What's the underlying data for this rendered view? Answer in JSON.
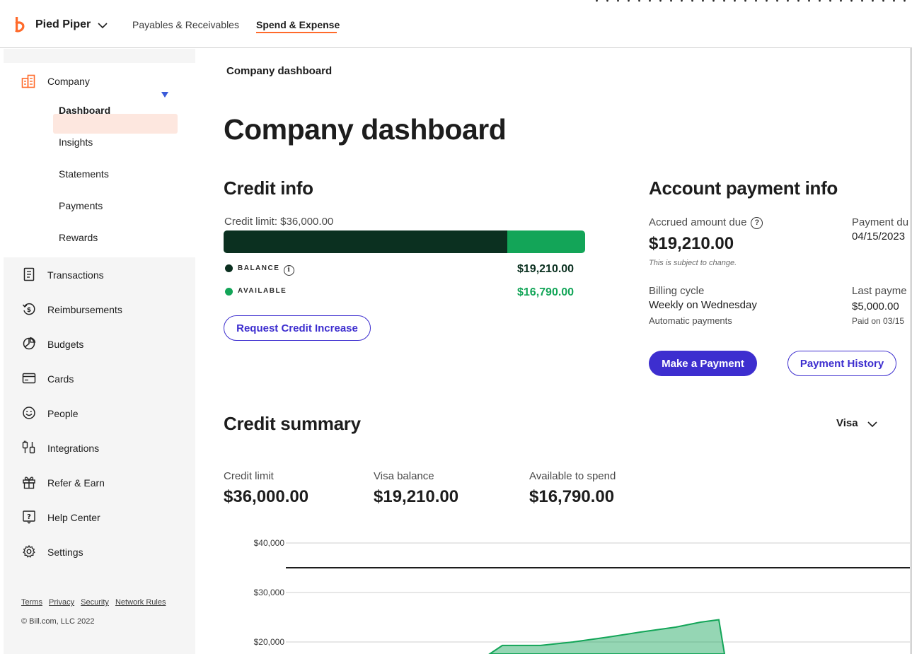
{
  "header": {
    "org_name": "Pied Piper",
    "nav": [
      {
        "label": "Payables & Receivables"
      },
      {
        "label": "Spend & Expense"
      }
    ],
    "accent_color": "#ff6a2a"
  },
  "sidebar": {
    "section": "Company",
    "sub_items": [
      {
        "label": "Dashboard",
        "active": true
      },
      {
        "label": "Insights"
      },
      {
        "label": "Statements"
      },
      {
        "label": "Payments"
      },
      {
        "label": "Rewards"
      }
    ],
    "items": [
      {
        "label": "Transactions",
        "icon": "receipt-icon"
      },
      {
        "label": "Reimbursements",
        "icon": "reimbursement-icon"
      },
      {
        "label": "Budgets",
        "icon": "pie-chart-icon"
      },
      {
        "label": "Cards",
        "icon": "card-icon"
      },
      {
        "label": "People",
        "icon": "smiley-icon"
      },
      {
        "label": "Integrations",
        "icon": "integrations-icon"
      },
      {
        "label": "Refer & Earn",
        "icon": "gift-icon"
      },
      {
        "label": "Help Center",
        "icon": "help-icon"
      },
      {
        "label": "Settings",
        "icon": "gear-icon"
      }
    ],
    "footer_links": [
      "Terms",
      "Privacy",
      "Security",
      "Network Rules"
    ],
    "copyright": "© Bill.com, LLC 2022"
  },
  "main": {
    "breadcrumb": "Company dashboard",
    "title": "Company dashboard",
    "credit_info": {
      "heading": "Credit info",
      "limit_label": "Credit limit: $36,000.00",
      "balance_label": "BALANCE",
      "balance_value": "$19,210.00",
      "available_label": "AVAILABLE",
      "available_value": "$16,790.00",
      "used_fraction": 0.784,
      "request_button": "Request Credit Increase",
      "balance_color": "#0b3020",
      "available_color": "#13a558"
    },
    "account_payment": {
      "heading": "Account payment info",
      "accrued_label": "Accrued amount due",
      "accrued_value": "$19,210.00",
      "accrued_note": "This is subject to change.",
      "payment_due_label": "Payment du",
      "payment_due_value": "04/15/2023",
      "billing_cycle_label": "Billing cycle",
      "billing_cycle_value": "Weekly on Wednesday",
      "billing_cycle_note": "Automatic payments",
      "last_payment_label": "Last payme",
      "last_payment_value": "$5,000.00",
      "last_payment_note": "Paid on 03/15",
      "make_payment_button": "Make a Payment",
      "history_button": "Payment History"
    },
    "credit_summary": {
      "heading": "Credit summary",
      "card_filter": "Visa",
      "stats": [
        {
          "label": "Credit limit",
          "value": "$36,000.00"
        },
        {
          "label": "Visa balance",
          "value": "$19,210.00"
        },
        {
          "label": "Available to spend",
          "value": "$16,790.00"
        }
      ]
    }
  },
  "chart_data": {
    "type": "area",
    "y_ticks": [
      {
        "label": "$40,000",
        "value": 40000
      },
      {
        "label": "$30,000",
        "value": 30000
      },
      {
        "label": "$20,000",
        "value": 20000
      }
    ],
    "limit_line": 35000,
    "series": [
      {
        "values": [
          17500,
          19300,
          19300,
          20000,
          21000,
          22000,
          23000,
          23000,
          24000,
          24500,
          17500
        ],
        "color": "#13a558"
      }
    ]
  }
}
